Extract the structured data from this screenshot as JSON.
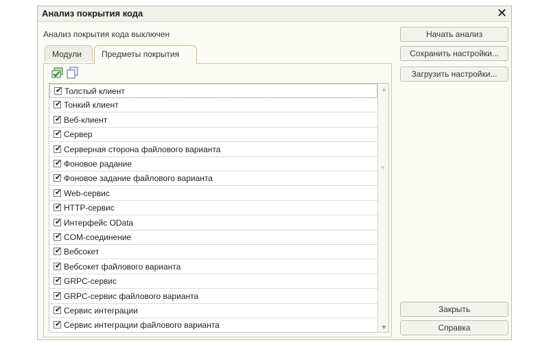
{
  "window": {
    "title": "Анализ покрытия кода",
    "close_glyph": "✕"
  },
  "status": "Анализ покрытия кода выключен",
  "tabs": [
    {
      "label": "Модули",
      "active": false
    },
    {
      "label": "Предметы покрытия",
      "active": true
    }
  ],
  "toolbar": {
    "icons": [
      "check-all-icon",
      "copy-icon"
    ]
  },
  "coverage_items": [
    {
      "label": "Толстый клиент",
      "checked": true
    },
    {
      "label": "Тонкий клиент",
      "checked": true
    },
    {
      "label": "Веб-клиент",
      "checked": true
    },
    {
      "label": "Сервер",
      "checked": true
    },
    {
      "label": "Серверная сторона файлового варианта",
      "checked": true
    },
    {
      "label": "Фоновое радание",
      "checked": true
    },
    {
      "label": "Фоновое задание файлового варианта",
      "checked": true
    },
    {
      "label": "Web-сервис",
      "checked": true
    },
    {
      "label": "HTTP-сервис",
      "checked": true
    },
    {
      "label": "Интерфейс OData",
      "checked": true
    },
    {
      "label": "COM-соединение",
      "checked": true
    },
    {
      "label": "Вебсокет",
      "checked": true
    },
    {
      "label": "Вебсокет файлового варианта",
      "checked": true
    },
    {
      "label": "GRPC-сервис",
      "checked": true
    },
    {
      "label": "GRPC-сервис файлового варианта",
      "checked": true
    },
    {
      "label": "Сервис интеграции",
      "checked": true
    },
    {
      "label": "Сервис интеграции файлового варианта",
      "checked": true
    }
  ],
  "buttons": {
    "start": "Начать анализ",
    "save": "Сохранить настройки...",
    "load": "Загрузить настройки...",
    "close": "Закрыть",
    "help": "Справка"
  },
  "colors": {
    "active_tab_border": "#d8b864",
    "window_bg": "#fbfbf6"
  }
}
